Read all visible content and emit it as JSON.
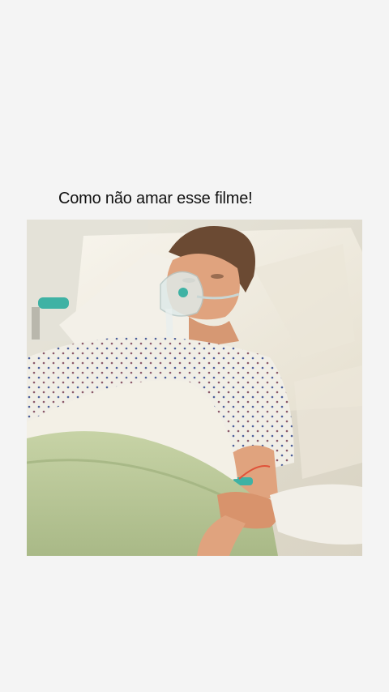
{
  "post": {
    "caption": "Como não amar esse filme!"
  },
  "photo": {
    "subject": "patient-in-hospital-bed",
    "colors": {
      "background": "#f4f4f4",
      "sheet": "#b9c79a",
      "gown": "#f1eee6",
      "pillow": "#f5f2ea",
      "skin": "#e0a37e",
      "hair": "#6b4a33"
    }
  }
}
